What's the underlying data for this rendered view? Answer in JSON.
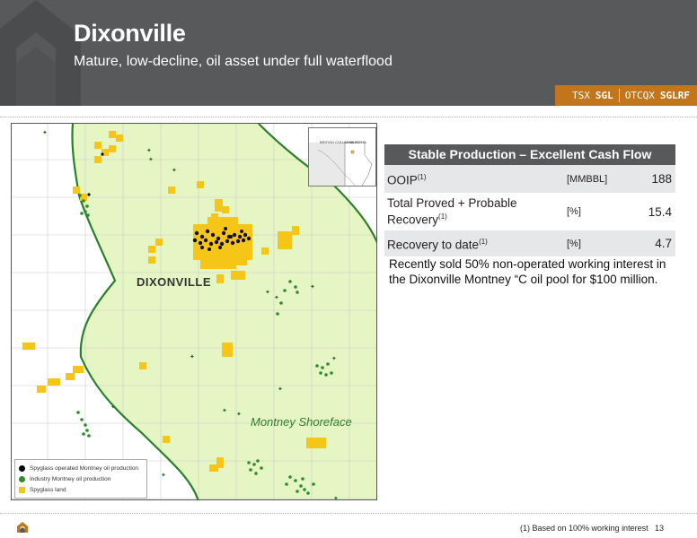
{
  "header": {
    "title": "Dixonville",
    "subtitle": "Mature, low-decline, oil asset under full waterflood",
    "ticker": {
      "exchange1": "TSX",
      "symbol1": "SGL",
      "exchange2": "OTCQX",
      "symbol2": "SGLRF"
    }
  },
  "map": {
    "town_label": "DIXONVILLE",
    "shoreface_label": "Montney Shoreface",
    "inset": {
      "label_left": "BRITISH COLUMBIA",
      "label_right": "ALBERTA"
    },
    "legend": [
      {
        "label": "Spyglass operated Montney oil production",
        "color": "#000000",
        "shape": "dot"
      },
      {
        "label": "Industry Montney oil production",
        "color": "#2e8b2e",
        "shape": "dot"
      },
      {
        "label": "Spyglass land",
        "color": "#f5c518",
        "shape": "square"
      }
    ],
    "colors": {
      "shoreface_fill": "#e6f5c4",
      "boundary": "#2b7f2b",
      "land": "#f5c518"
    }
  },
  "table": {
    "header": "Stable Production – Excellent Cash Flow",
    "rows": [
      {
        "label": "OOIP",
        "label2": "",
        "sup": "(1)",
        "unit": "[MMBBL]",
        "value": "188"
      },
      {
        "label": "Total Proved + Probable",
        "label2": "Recovery",
        "sup": "(1)",
        "unit": "[%]",
        "value": "15.4"
      },
      {
        "label": "Recovery to date",
        "label2": "",
        "sup": "(1)",
        "unit": "[%]",
        "value": "4.7"
      }
    ]
  },
  "note": "Recently sold 50% non-operated working interest in the Dixonville Montney “C oil pool for $100 million.",
  "footer": {
    "footnote": "(1) Based on 100% working interest",
    "page": "13"
  }
}
